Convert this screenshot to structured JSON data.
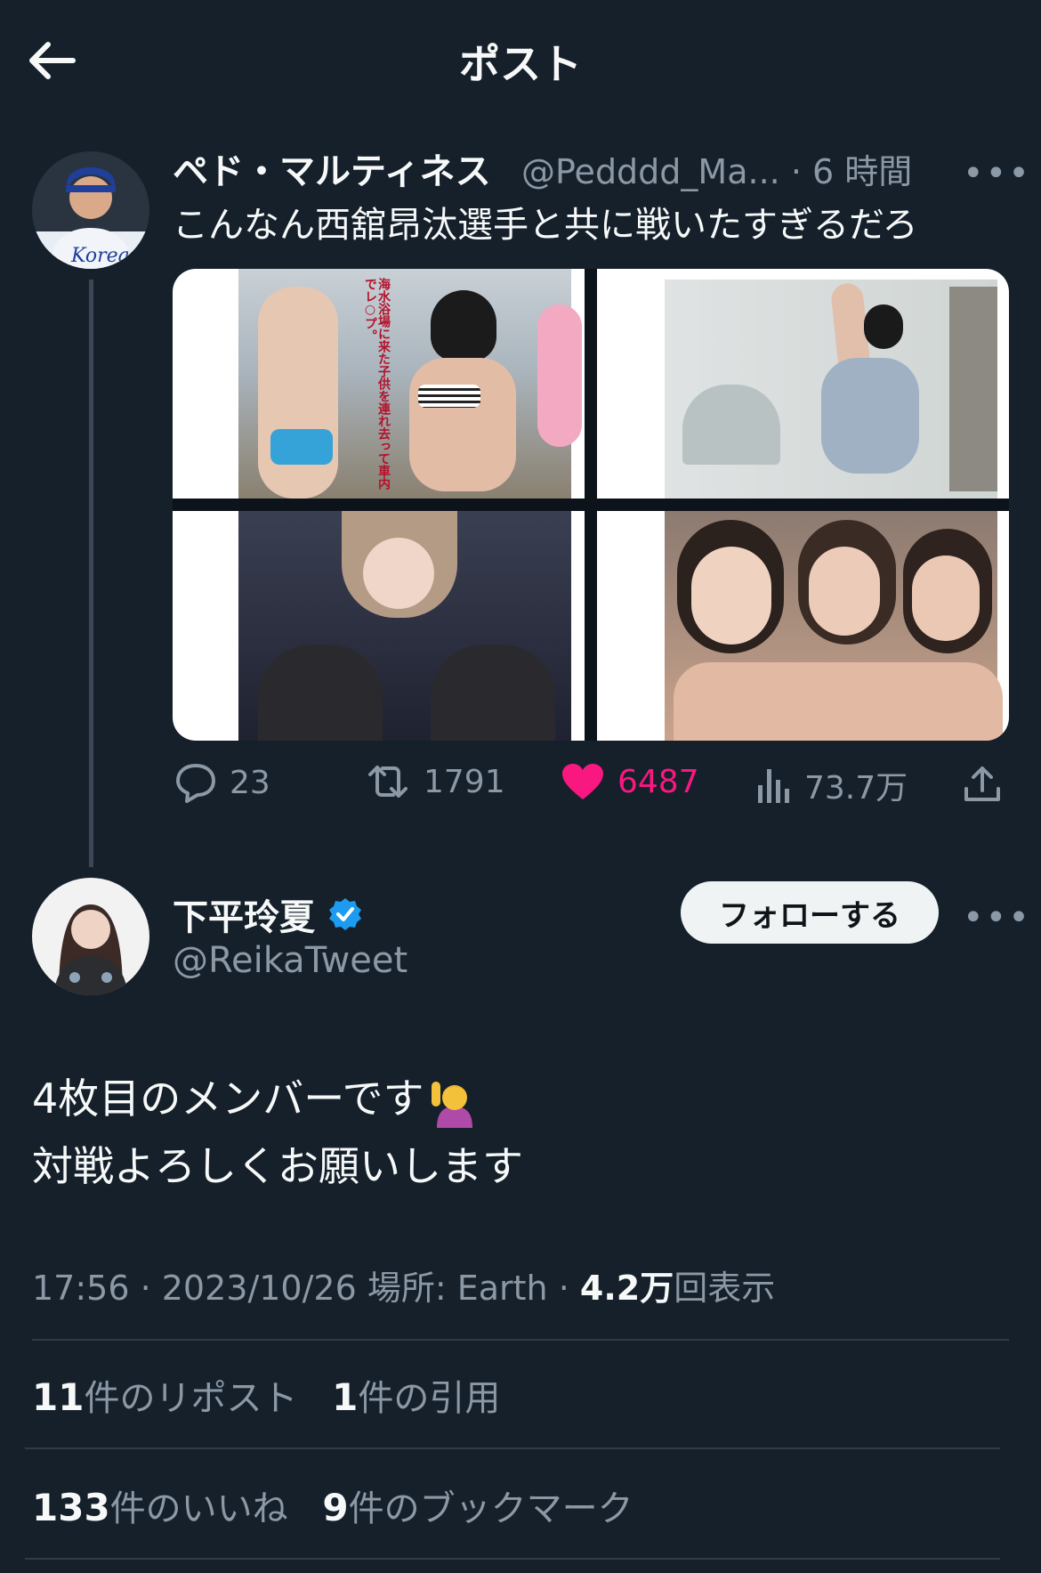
{
  "header": {
    "title": "ポスト"
  },
  "parent": {
    "display_name": "ペド・マルティネス",
    "handle_time": "@Pedddd_Ma... · 6 時間",
    "text": "こんなん西舘昂汰選手と共に戦いたすぎるだろ",
    "photo_caption": "海水浴場に来た子供を連れ去って車内でレ○プ。",
    "avatar_jersey_text": "Korea",
    "actions": {
      "replies": "23",
      "reposts": "1791",
      "likes": "6487",
      "views": "73.7万"
    }
  },
  "main": {
    "display_name": "下平玲夏",
    "handle": "@ReikaTweet",
    "follow_label": "フォローする",
    "text_line1": "4枚目のメンバーです",
    "text_line2": "対戦よろしくお願いします",
    "meta_time": "17:56 · 2023/10/26 場所: Earth · ",
    "meta_views": "4.2万",
    "meta_views_suffix": "回表示",
    "stats": {
      "reposts_count": "11",
      "reposts_label": "件のリポスト",
      "quotes_count": "1",
      "quotes_label": "件の引用",
      "likes_count": "133",
      "likes_label": "件のいいね",
      "bookmarks_count": "9",
      "bookmarks_label": "件のブックマーク"
    }
  },
  "colors": {
    "background": "#15202b",
    "like": "#f91880",
    "muted": "#8b98a5",
    "verified": "#1d9bf0"
  }
}
